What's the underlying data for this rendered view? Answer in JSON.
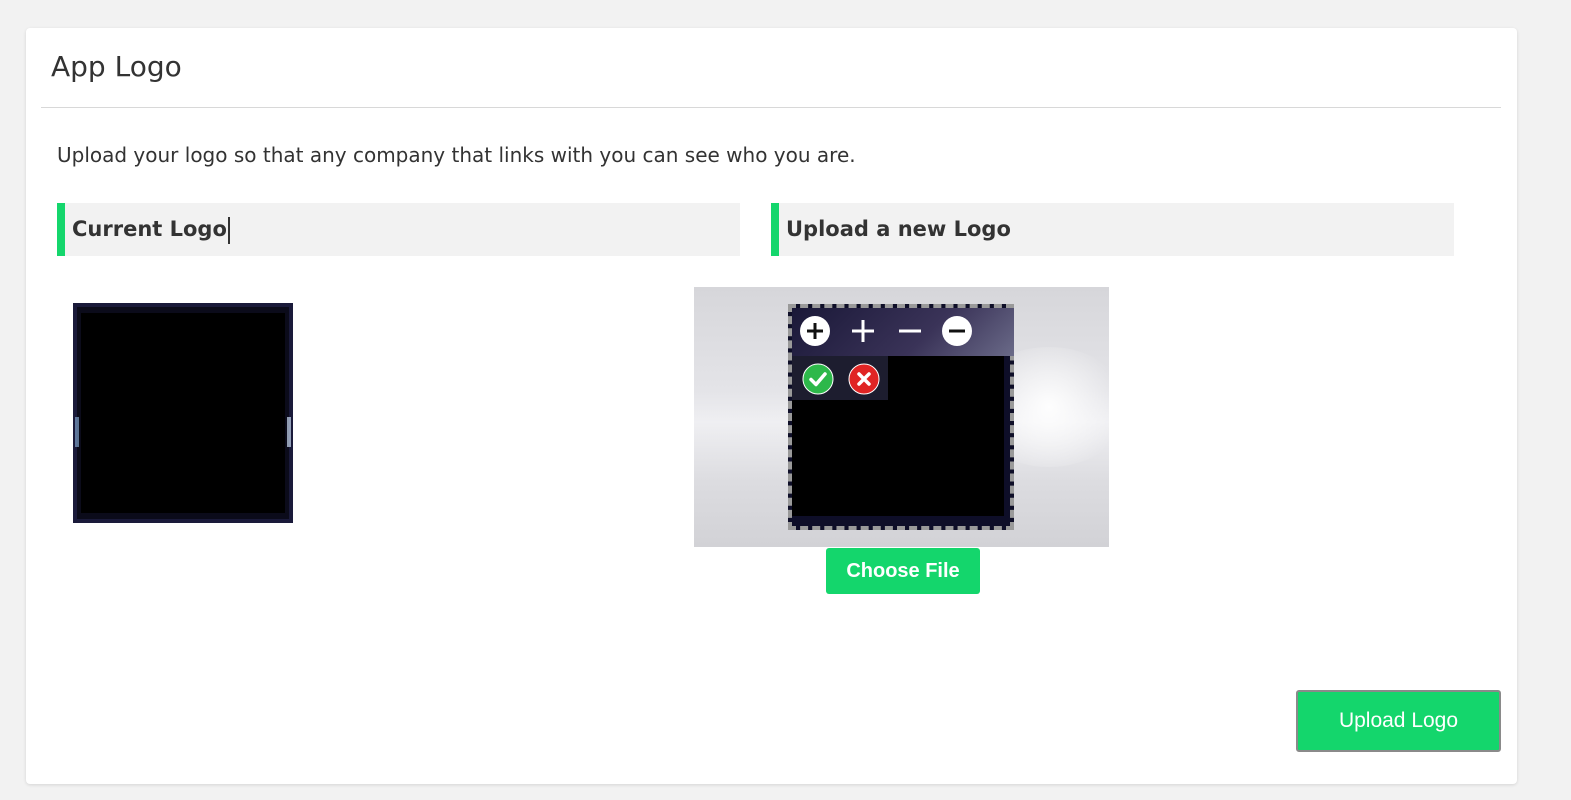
{
  "card": {
    "title": "App Logo",
    "intro": "Upload your logo so that any company that links with you can see who you are."
  },
  "sections": {
    "current_label": "Current Logo",
    "upload_label": "Upload a new Logo"
  },
  "cropper": {
    "tools": [
      "zoom-in-circle-icon",
      "zoom-in-icon",
      "zoom-out-icon",
      "zoom-out-circle-icon",
      "confirm-check-icon",
      "cancel-x-icon"
    ]
  },
  "buttons": {
    "choose_file": "Choose File",
    "upload_logo": "Upload Logo"
  },
  "colors": {
    "accent": "#14d66c",
    "confirm": "#2db84a",
    "cancel": "#e02424",
    "background": "#f2f2f2"
  }
}
